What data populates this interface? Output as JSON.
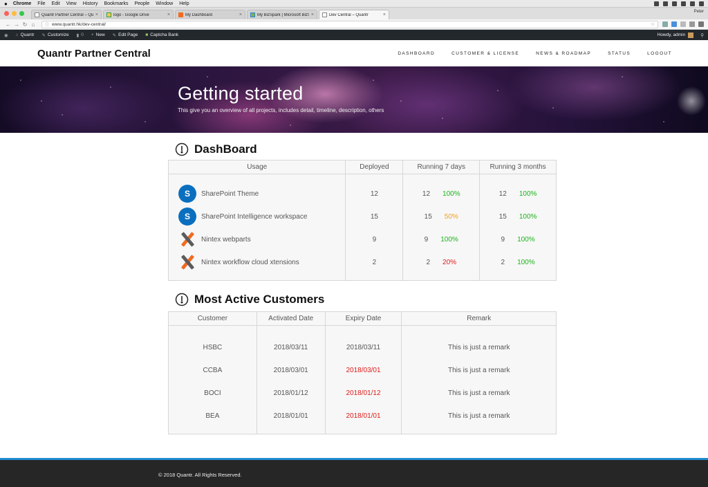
{
  "mac_menu": {
    "apple": "",
    "app": "Chrome",
    "items": [
      "File",
      "Edit",
      "View",
      "History",
      "Bookmarks",
      "People",
      "Window",
      "Help"
    ]
  },
  "browser": {
    "tabs": [
      {
        "label": "Quantr Partner Central – Quar",
        "active": false
      },
      {
        "label": "logo - Google Drive",
        "active": false
      },
      {
        "label": "My Dashboard",
        "active": false
      },
      {
        "label": "My BizSpark | Microsoft BizSp",
        "active": false
      },
      {
        "label": "Dev Central – Quantr",
        "active": true
      }
    ],
    "profile": "Peter",
    "url": "www.quantr.hk/dev-central/"
  },
  "wp_admin_bar": {
    "site": "Quantr",
    "customize": "Customize",
    "comments": "0",
    "new": "New",
    "edit_page": "Edit Page",
    "captcha": "Captcha Bank",
    "howdy": "Howdy, admin"
  },
  "site": {
    "title": "Quantr Partner Central",
    "nav": [
      "DASHBOARD",
      "CUSTOMER & LICENSE",
      "NEWS & ROADMAP",
      "STATUS",
      "LOGOUT"
    ]
  },
  "hero": {
    "title": "Getting started",
    "subtitle": "This give you an overview of all projects, includes detail, timeline, description, others"
  },
  "dashboard": {
    "title": "DashBoard",
    "headers": [
      "Usage",
      "Deployed",
      "Running 7 days",
      "Running 3 months"
    ],
    "rows": [
      {
        "icon": "sharepoint",
        "name": "SharePoint Theme",
        "deployed": "12",
        "r7_count": "12",
        "r7_pct": "100%",
        "r7_status": "green",
        "r3_count": "12",
        "r3_pct": "100%",
        "r3_status": "green"
      },
      {
        "icon": "sharepoint",
        "name": "SharePoint Intelligence workspace",
        "deployed": "15",
        "r7_count": "15",
        "r7_pct": "50%",
        "r7_status": "orange",
        "r3_count": "15",
        "r3_pct": "100%",
        "r3_status": "green"
      },
      {
        "icon": "nintex",
        "name": "Nintex webparts",
        "deployed": "9",
        "r7_count": "9",
        "r7_pct": "100%",
        "r7_status": "green",
        "r3_count": "9",
        "r3_pct": "100%",
        "r3_status": "green"
      },
      {
        "icon": "nintex",
        "name": "Nintex workflow cloud xtensions",
        "deployed": "2",
        "r7_count": "2",
        "r7_pct": "20%",
        "r7_status": "red",
        "r3_count": "2",
        "r3_pct": "100%",
        "r3_status": "green"
      }
    ]
  },
  "customers": {
    "title": "Most Active Customers",
    "headers": [
      "Customer",
      "Activated Date",
      "Expiry Date",
      "Remark"
    ],
    "rows": [
      {
        "name": "HSBC",
        "activated": "2018/03/11",
        "expiry": "2018/03/11",
        "expired": false,
        "remark": "This is just a remark"
      },
      {
        "name": "CCBA",
        "activated": "2018/03/01",
        "expiry": "2018/03/01",
        "expired": true,
        "remark": "This is just a remark"
      },
      {
        "name": "BOCI",
        "activated": "2018/01/12",
        "expiry": "2018/01/12",
        "expired": true,
        "remark": "This is just a remark"
      },
      {
        "name": "BEA",
        "activated": "2018/01/01",
        "expiry": "2018/01/01",
        "expired": true,
        "remark": "This is just a remark"
      }
    ]
  },
  "footer": {
    "text": "© 2018 Quantr. All Rights Reserved."
  },
  "colors": {
    "ok": "#1bb31b",
    "warn": "#f0a020",
    "bad": "#e01b1b",
    "footer_accent": "#1e8bd0",
    "sharepoint": "#0b6fbf",
    "nintex": "#f26b21"
  }
}
